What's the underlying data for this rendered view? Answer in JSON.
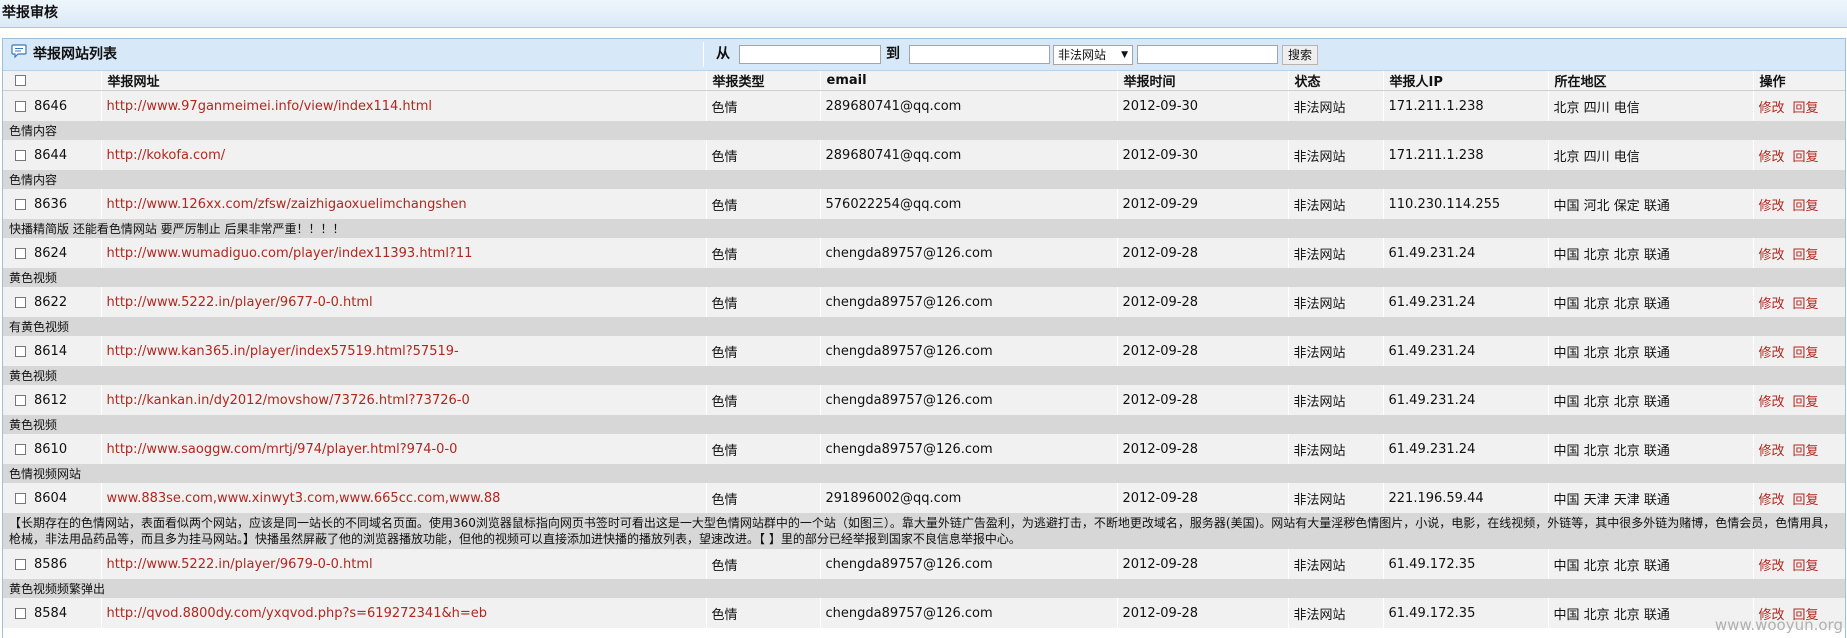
{
  "page": {
    "title": "举报审核"
  },
  "toolbar": {
    "list_title": "举报网站列表",
    "from_label": "从",
    "to_label": "到",
    "type_select": "非法网站",
    "search_button": "搜索"
  },
  "table": {
    "headers": {
      "url": "举报网址",
      "type": "举报类型",
      "email": "email",
      "time": "举报时间",
      "status": "状态",
      "ip": "举报人IP",
      "region": "所在地区",
      "action": "操作"
    },
    "rows": [
      {
        "id": "8646",
        "url": "http://www.97ganmeimei.info/view/index114.html",
        "type": "色情",
        "email": "289680741@qq.com",
        "time": "2012-09-30",
        "status": "非法网站",
        "ip": "171.211.1.238",
        "region": "北京 四川 电信",
        "edit": "修改",
        "reply": "回复",
        "desc": "色情内容"
      },
      {
        "id": "8644",
        "url": "http://kokofa.com/",
        "type": "色情",
        "email": "289680741@qq.com",
        "time": "2012-09-30",
        "status": "非法网站",
        "ip": "171.211.1.238",
        "region": "北京 四川 电信",
        "edit": "修改",
        "reply": "回复",
        "desc": "色情内容"
      },
      {
        "id": "8636",
        "url": "http://www.126xx.com/zfsw/zaizhigaoxuelimchangshen",
        "type": "色情",
        "email": "576022254@qq.com",
        "time": "2012-09-29",
        "status": "非法网站",
        "ip": "110.230.114.255",
        "region": "中国 河北 保定 联通",
        "edit": "修改",
        "reply": "回复",
        "desc": "快播精简版 还能看色情网站 要严厉制止 后果非常严重！！！！"
      },
      {
        "id": "8624",
        "url": "http://www.wumadiguo.com/player/index11393.html?11",
        "type": "色情",
        "email": "chengda89757@126.com",
        "time": "2012-09-28",
        "status": "非法网站",
        "ip": "61.49.231.24",
        "region": "中国 北京 北京 联通",
        "edit": "修改",
        "reply": "回复",
        "desc": "黄色视频"
      },
      {
        "id": "8622",
        "url": "http://www.5222.in/player/9677-0-0.html",
        "type": "色情",
        "email": "chengda89757@126.com",
        "time": "2012-09-28",
        "status": "非法网站",
        "ip": "61.49.231.24",
        "region": "中国 北京 北京 联通",
        "edit": "修改",
        "reply": "回复",
        "desc": "有黄色视频"
      },
      {
        "id": "8614",
        "url": "http://www.kan365.in/player/index57519.html?57519-",
        "type": "色情",
        "email": "chengda89757@126.com",
        "time": "2012-09-28",
        "status": "非法网站",
        "ip": "61.49.231.24",
        "region": "中国 北京 北京 联通",
        "edit": "修改",
        "reply": "回复",
        "desc": "黄色视频"
      },
      {
        "id": "8612",
        "url": "http://kankan.in/dy2012/movshow/73726.html?73726-0",
        "type": "色情",
        "email": "chengda89757@126.com",
        "time": "2012-09-28",
        "status": "非法网站",
        "ip": "61.49.231.24",
        "region": "中国 北京 北京 联通",
        "edit": "修改",
        "reply": "回复",
        "desc": "黄色视频"
      },
      {
        "id": "8610",
        "url": "http://www.saoggw.com/mrtj/974/player.html?974-0-0",
        "type": "色情",
        "email": "chengda89757@126.com",
        "time": "2012-09-28",
        "status": "非法网站",
        "ip": "61.49.231.24",
        "region": "中国 北京 北京 联通",
        "edit": "修改",
        "reply": "回复",
        "desc": "色情视频网站"
      },
      {
        "id": "8604",
        "url": "www.883se.com,www.xinwyt3.com,www.665cc.com,www.88",
        "type": "色情",
        "email": "291896002@qq.com",
        "time": "2012-09-28",
        "status": "非法网站",
        "ip": "221.196.59.44",
        "region": "中国 天津 天津 联通",
        "edit": "修改",
        "reply": "回复",
        "desc": "【长期存在的色情网站，表面看似两个网站，应该是同一站长的不同域名页面。使用360浏览器鼠标指向网页书签时可看出这是一大型色情网站群中的一个站（如图三）。靠大量外链广告盈利，为逃避打击，不断地更改域名，服务器(美国)。网站有大量淫秽色情图片，小说，电影，在线视频，外链等，其中很多外链为赌博，色情会员，色情用具，枪械，非法用品药品等，而且多为挂马网站。】快播虽然屏蔽了他的浏览器播放功能，但他的视频可以直接添加进快播的播放列表，望速改进。【 】里的部分已经举报到国家不良信息举报中心。",
        "long": true
      },
      {
        "id": "8586",
        "url": "http://www.5222.in/player/9679-0-0.html",
        "type": "色情",
        "email": "chengda89757@126.com",
        "time": "2012-09-28",
        "status": "非法网站",
        "ip": "61.49.172.35",
        "region": "中国 北京 北京 联通",
        "edit": "修改",
        "reply": "回复",
        "desc": "黄色视频频繁弹出"
      },
      {
        "id": "8584",
        "url": "http://qvod.8800dy.com/yxqvod.php?s=619272341&h=eb",
        "type": "色情",
        "email": "chengda89757@126.com",
        "time": "2012-09-28",
        "status": "非法网站",
        "ip": "61.49.172.35",
        "region": "中国 北京 北京 联通",
        "edit": "修改",
        "reply": "回复",
        "desc": ""
      }
    ]
  },
  "watermark": "www.wooyun.org"
}
